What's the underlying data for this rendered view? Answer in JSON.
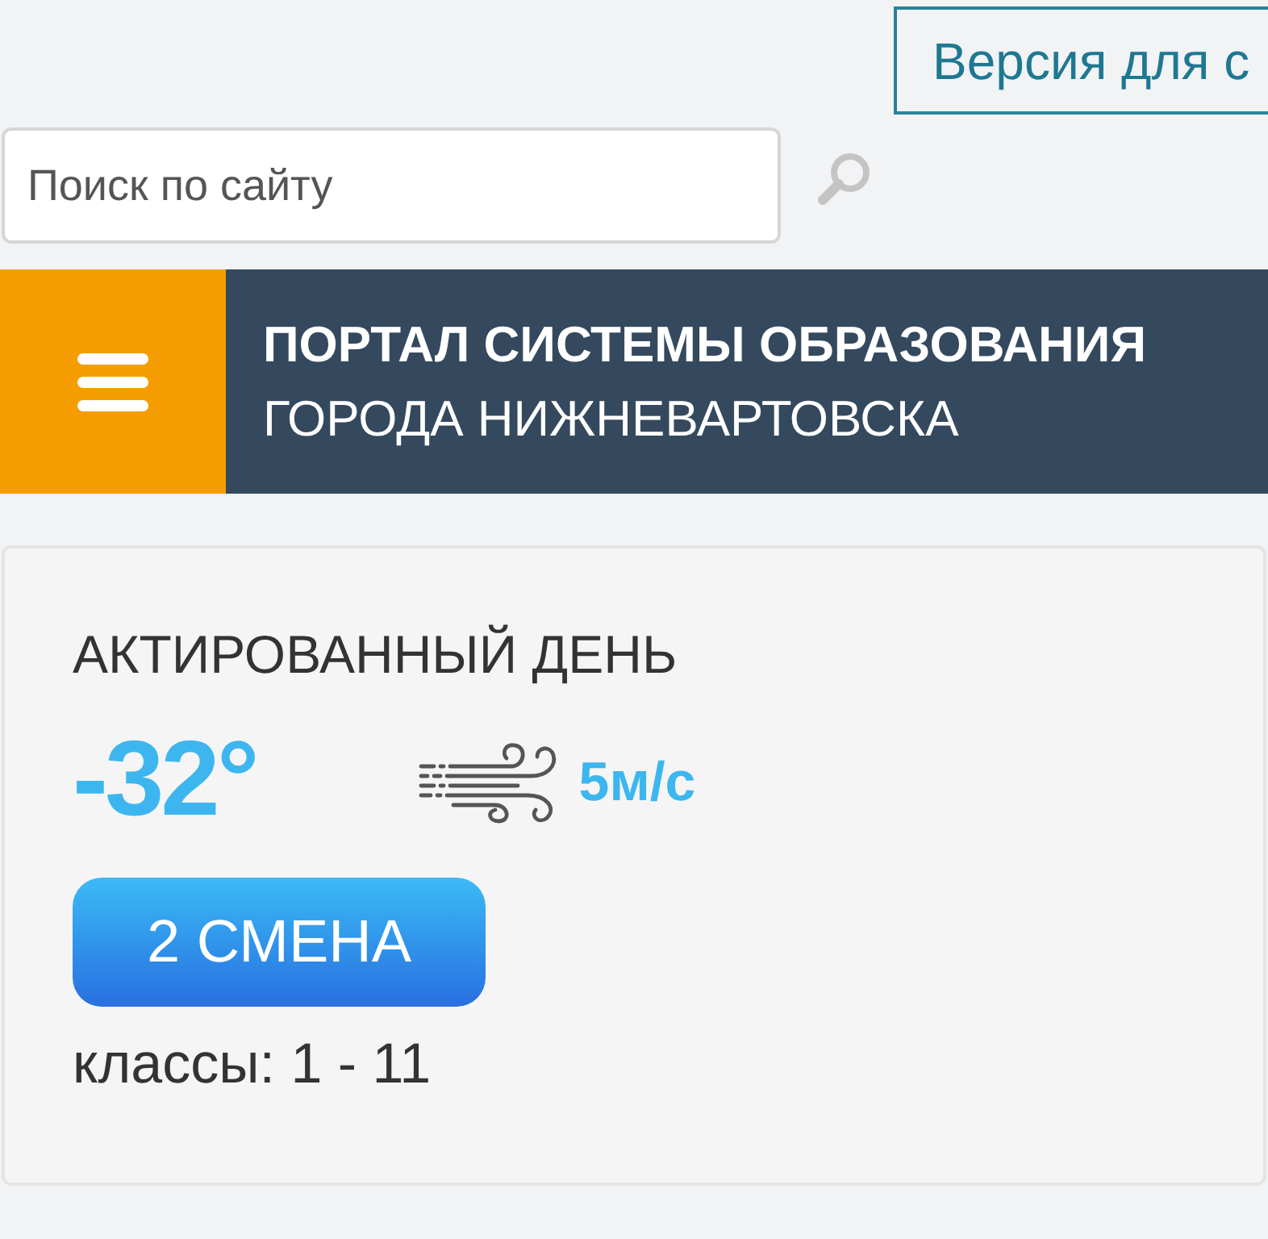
{
  "top_bar": {
    "accessibility_button": "Версия для с"
  },
  "search": {
    "placeholder": "Поиск по сайту"
  },
  "header": {
    "title_line_1": "ПОРТАЛ СИСТЕМЫ ОБРАЗОВАНИЯ",
    "title_line_2": "ГОРОДА НИЖНЕВАРТОВСКА"
  },
  "weather_card": {
    "title": "АКТИРОВАННЫЙ ДЕНЬ",
    "temperature": "-32°",
    "wind": "5м/с",
    "shift_badge": "2 СМЕНА",
    "grades": "классы: 1 - 11"
  }
}
